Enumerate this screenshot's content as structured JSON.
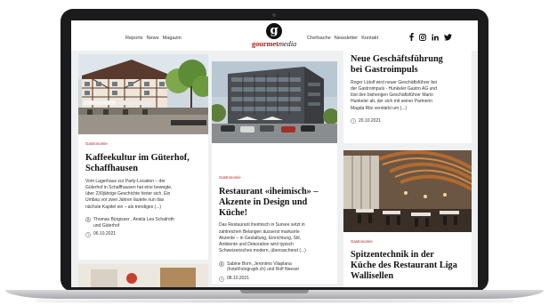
{
  "nav": {
    "left": [
      "Reports",
      "News",
      "Magazin"
    ],
    "right": [
      "Chefsache",
      "Newsletter",
      "Kontakt"
    ]
  },
  "logo": {
    "mark": "g",
    "text_bold": "gourmet",
    "text_italic": "media"
  },
  "social": [
    "facebook-icon",
    "instagram-icon",
    "linkedin-icon",
    "twitter-icon"
  ],
  "cards": {
    "card1": {
      "category": "Gastronomie",
      "title_lines": [
        "Kaffeekultur im Güterhof,",
        "Schaffhausen"
      ],
      "excerpt_lines": [
        "Vom Lagerhaus zur Party-Location – der",
        "Güterhof in Schaffhausen hat eine bewegte,",
        "über 230jährige Geschichte hinter sich. Ein",
        "Umbau vor zwei Jahren läutete nun das",
        "nächste Kapitel ein – als trendiges (...)"
      ],
      "authors_lines": [
        "Thomas Bürgisser , Aniela Lea Schafroth",
        "und Güterhof"
      ],
      "date": "06.10.2021"
    },
    "card2": {
      "category": "Gastronomie",
      "title_lines": [
        "Restaurant «iheimisch» –",
        "Akzente in Design und",
        "Küche!"
      ],
      "excerpt_lines": [
        "Das Restaurant iheimisch in Sursee setzt in",
        "zahlreichen Belangen äusserst markante",
        "Akzente – in Gestaltung, Einrichtung, Stil,",
        "Ambiente und Dekoration wird typisch",
        "Schweizerisches modern, überraschend (...)"
      ],
      "authors_lines": [
        "Sabine Born, Jeronimo Vilaplana",
        "(hotelFotograph.ch) und Rolf Neeser"
      ],
      "date": "08.10.2021"
    },
    "card3": {
      "title_lines": [
        "Neue Geschäftsführung",
        "bei Gastroimpuls"
      ],
      "excerpt_lines": [
        "Roger Lütolf wird neuer Geschäftsführer bei",
        "der Gastroimpuls - Hunkeler Gastro AG und",
        "löst den bisherigen Geschäftsführer Mario",
        "Hunkeler ab, der sich mit seiner Partnerin",
        "Magda Ritz verstärkt um (...)"
      ],
      "date": "20.10.2021"
    },
    "card4": {
      "category": "Gastronomie",
      "title_lines": [
        "Spitzentechnik in der",
        "Küche des Restaurant Liga",
        "Wallisellen"
      ]
    }
  }
}
